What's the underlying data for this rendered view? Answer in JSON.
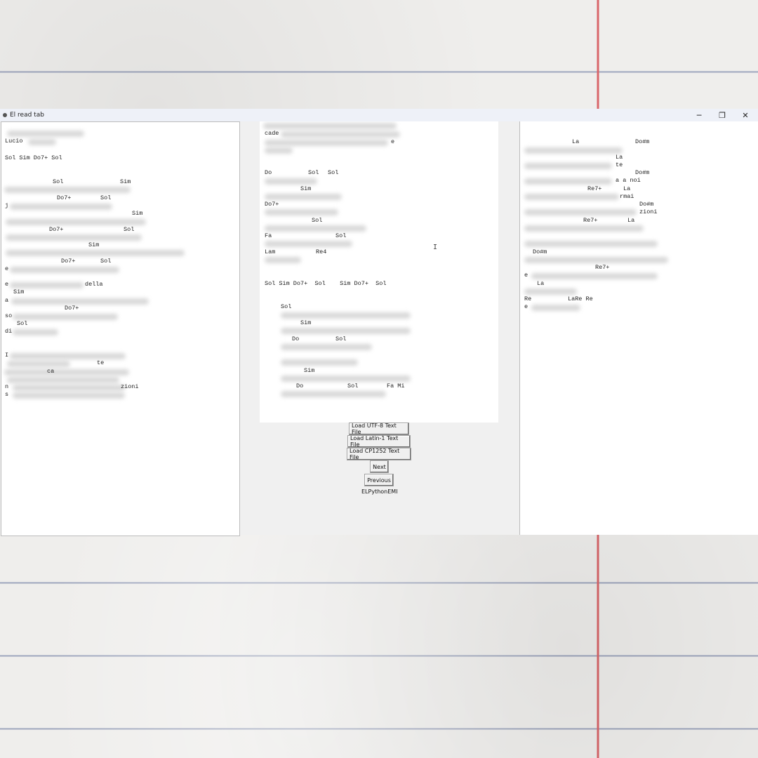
{
  "window": {
    "title": "El read tab",
    "minimize_icon": "minimize-icon",
    "restore_icon": "restore-icon",
    "close_icon": "close-icon",
    "minimize_glyph": "─",
    "restore_glyph": "❐",
    "close_glyph": "✕"
  },
  "left_pane": {
    "lines": [
      "Lucio",
      "Sol Sim Do7+ Sol",
      "Sol",
      "Sim",
      "Do7+",
      "Sol",
      "j",
      "Sim",
      "Do7+",
      "Sol",
      "Sim",
      "Do7+",
      "Sol",
      "e",
      "e",
      "della",
      "Sim",
      "a",
      "Do7+",
      "so",
      "Sol",
      "di",
      "I",
      "ca",
      "te",
      "zioni",
      "n",
      "s"
    ]
  },
  "middle_pane": {
    "lines": [
      "cade",
      "e",
      "Do",
      "Sol",
      "Sol",
      "Sim",
      "Do7+",
      "Sol",
      "Fa",
      "Sol",
      "Lam",
      "Re4",
      "Sol Sim Do7+  Sol    Sim Do7+  Sol",
      "Sol",
      "Sim",
      "Do",
      "Sol",
      "Sim",
      "Do",
      "Sol",
      "Fa Mi"
    ]
  },
  "right_pane": {
    "lines": [
      "La",
      "Do#m",
      "La",
      "te",
      "Do#m",
      "a a noi",
      "Re7+",
      "La",
      "rmai",
      "Do#m",
      "zioni",
      "Re7+",
      "La",
      "Do#m",
      "Re7+",
      "e",
      "La",
      "Re",
      "LaRe Re",
      "e"
    ]
  },
  "controls": {
    "load_utf8": "Load UTF-8 Text File",
    "load_latin1": "Load Latin-1 Text File",
    "load_cp1252": "Load CP1252 Text File",
    "next": "Next",
    "previous": "Previous",
    "footer": "ELPythonEMI"
  },
  "text_cursor": "I"
}
